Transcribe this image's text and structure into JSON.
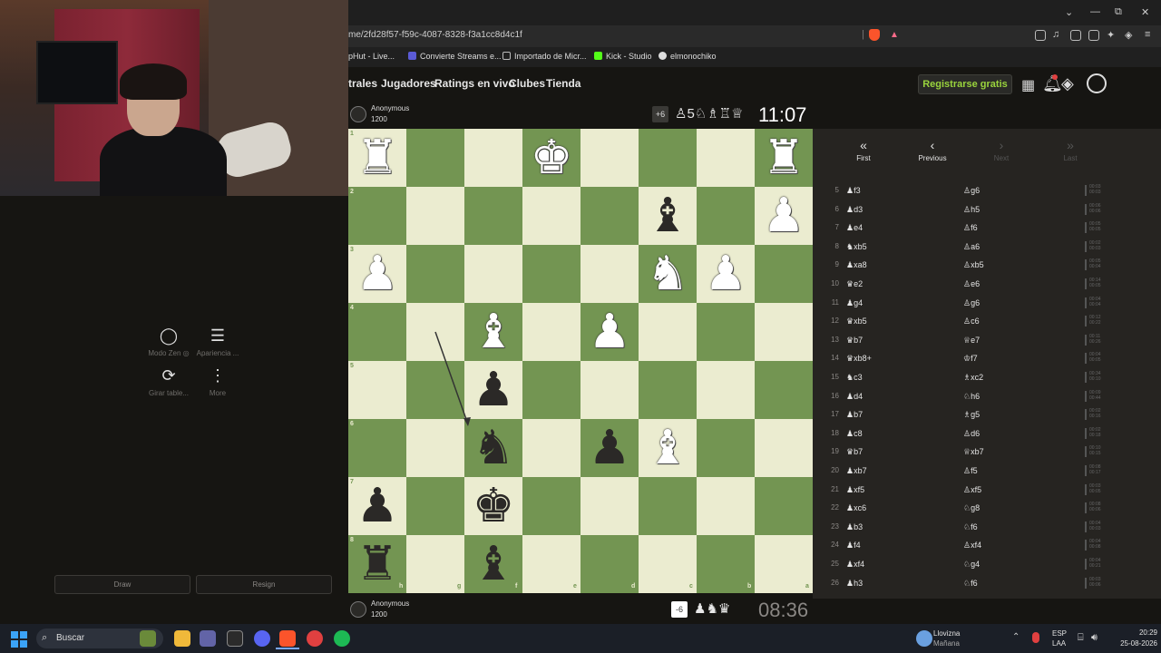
{
  "browser": {
    "url": "me/2fd28f57-f59c-4087-8328-f3a1cc8d4c1f",
    "bookmarks": [
      "pHut - Live...",
      "Convierte Streams e...",
      "Importado de Micr...",
      "Kick - Studio",
      "elmonochiko"
    ],
    "window_controls": [
      "⌄",
      "—",
      "⧉",
      "✕"
    ]
  },
  "site_nav": {
    "items": [
      "trales",
      "Jugadores",
      "Ratings en vivo",
      "Clubes",
      "Tienda"
    ],
    "signup_label": "Registrarse gratis"
  },
  "left_panel": {
    "tools": [
      {
        "icon": "circle-icon",
        "glyph": "◯",
        "label": "Modo Zen ◎"
      },
      {
        "icon": "sliders-icon",
        "glyph": "☰",
        "label": "Apariencia ..."
      },
      {
        "icon": "rotate-icon",
        "glyph": "⟳",
        "label": "Girar table..."
      },
      {
        "icon": "more-icon",
        "glyph": "⋮",
        "label": "More"
      }
    ],
    "draw_label": "Draw",
    "resign_label": "Resign"
  },
  "top_player": {
    "name": "Anonymous",
    "rating": "1200",
    "advantage": "+6",
    "captured": "♙5♘♗♖♕",
    "clock": "11:07"
  },
  "bottom_player": {
    "name": "Anonymous",
    "rating": "1200",
    "advantage": "-6",
    "captured": "♟♞♛",
    "clock": "08:36"
  },
  "board": {
    "files_bottom": [
      "h",
      "g",
      "f",
      "e",
      "d",
      "c",
      "b",
      "a"
    ],
    "ranks_left": [
      "1",
      "2",
      "3",
      "4",
      "5",
      "6",
      "7",
      "8"
    ],
    "pieces": [
      {
        "sq": "h1",
        "color": "w",
        "glyph": "♜"
      },
      {
        "sq": "e1",
        "color": "w",
        "glyph": "♚"
      },
      {
        "sq": "a1",
        "color": "w",
        "glyph": "♜"
      },
      {
        "sq": "c2",
        "color": "b",
        "glyph": "♝"
      },
      {
        "sq": "a2",
        "color": "w",
        "glyph": "♟"
      },
      {
        "sq": "h3",
        "color": "w",
        "glyph": "♟"
      },
      {
        "sq": "c3",
        "color": "w",
        "glyph": "♞"
      },
      {
        "sq": "b3",
        "color": "w",
        "glyph": "♟"
      },
      {
        "sq": "f4",
        "color": "w",
        "glyph": "♝"
      },
      {
        "sq": "d4",
        "color": "w",
        "glyph": "♟"
      },
      {
        "sq": "f5",
        "color": "b",
        "glyph": "♟"
      },
      {
        "sq": "f6",
        "color": "b",
        "glyph": "♞"
      },
      {
        "sq": "d6",
        "color": "b",
        "glyph": "♟"
      },
      {
        "sq": "c6",
        "color": "w",
        "glyph": "♝"
      },
      {
        "sq": "h7",
        "color": "b",
        "glyph": "♟"
      },
      {
        "sq": "f7",
        "color": "b",
        "glyph": "♚"
      },
      {
        "sq": "h8",
        "color": "b",
        "glyph": "♜"
      },
      {
        "sq": "f8",
        "color": "b",
        "glyph": "♝"
      }
    ]
  },
  "move_nav": [
    "First",
    "Previous",
    "Next",
    "Last"
  ],
  "moves": [
    {
      "n": "5",
      "w": "♟f3",
      "b": "♙g6",
      "tw": "00:03",
      "tb": "00:03"
    },
    {
      "n": "6",
      "w": "♟d3",
      "b": "♙h5",
      "tw": "00:06",
      "tb": "00:06"
    },
    {
      "n": "7",
      "w": "♟e4",
      "b": "♙f6",
      "tw": "00:05",
      "tb": "00:05"
    },
    {
      "n": "8",
      "w": "♞xb5",
      "b": "♙a6",
      "tw": "00:02",
      "tb": "00:03"
    },
    {
      "n": "9",
      "w": "♟xa8",
      "b": "♙xb5",
      "tw": "00:05",
      "tb": "00:04"
    },
    {
      "n": "10",
      "w": "♛e2",
      "b": "♙e6",
      "tw": "00:14",
      "tb": "00:05"
    },
    {
      "n": "11",
      "w": "♟g4",
      "b": "♙g6",
      "tw": "00:04",
      "tb": "00:04"
    },
    {
      "n": "12",
      "w": "♛xb5",
      "b": "♙c6",
      "tw": "00:12",
      "tb": "00:22"
    },
    {
      "n": "13",
      "w": "♛b7",
      "b": "♕e7",
      "tw": "00:11",
      "tb": "00:26"
    },
    {
      "n": "14",
      "w": "♛xb8+",
      "b": "♔f7",
      "tw": "00:04",
      "tb": "00:05"
    },
    {
      "n": "15",
      "w": "♞c3",
      "b": "♗xc2",
      "tw": "00:34",
      "tb": "00:10"
    },
    {
      "n": "16",
      "w": "♟d4",
      "b": "♘h6",
      "tw": "00:09",
      "tb": "00:44"
    },
    {
      "n": "17",
      "w": "♟b7",
      "b": "♗g5",
      "tw": "00:02",
      "tb": "00:16"
    },
    {
      "n": "18",
      "w": "♟c8",
      "b": "♙d6",
      "tw": "00:02",
      "tb": "00:18"
    },
    {
      "n": "19",
      "w": "♛b7",
      "b": "♕xb7",
      "tw": "00:10",
      "tb": "00:15"
    },
    {
      "n": "20",
      "w": "♟xb7",
      "b": "♙f5",
      "tw": "00:08",
      "tb": "00:17"
    },
    {
      "n": "21",
      "w": "♟xf5",
      "b": "♙xf5",
      "tw": "00:03",
      "tb": "00:05"
    },
    {
      "n": "22",
      "w": "♟xc6",
      "b": "♘g8",
      "tw": "00:08",
      "tb": "00:06"
    },
    {
      "n": "23",
      "w": "♟b3",
      "b": "♘f6",
      "tw": "00:04",
      "tb": "00:03"
    },
    {
      "n": "24",
      "w": "♟f4",
      "b": "♙xf4",
      "tw": "00:04",
      "tb": "00:08"
    },
    {
      "n": "25",
      "w": "♟xf4",
      "b": "♘g4",
      "tw": "00:04",
      "tb": "00:21"
    },
    {
      "n": "26",
      "w": "♟h3",
      "b": "♘f6",
      "tw": "00:03",
      "tb": "00:06"
    }
  ],
  "taskbar": {
    "search_placeholder": "Buscar",
    "weather_title": "Llovizna",
    "weather_sub": "Mañana",
    "lang_top": "ESP",
    "lang_bottom": "LAA",
    "time": "20:29",
    "date": "25-08-2026"
  },
  "colors": {
    "board_light": "#ebecd0",
    "board_dark": "#739552",
    "signup_green": "#9ad43d",
    "brave_orange": "#fb542b"
  }
}
